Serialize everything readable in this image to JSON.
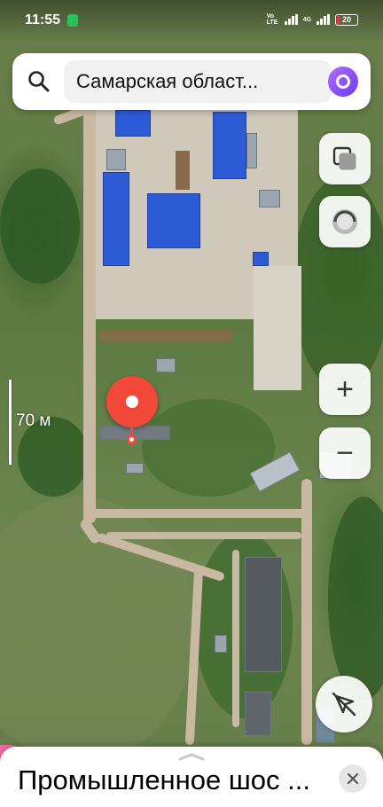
{
  "status_bar": {
    "time": "11:55",
    "volte_tag": "Vo LTE",
    "network_tag": "4G",
    "battery_level": "20",
    "battery_color": "#e23b3b"
  },
  "search": {
    "value": "Самарская област...",
    "icon": "search-icon",
    "assistant_icon": "alice-icon"
  },
  "controls": {
    "layers_icon": "layers-icon",
    "traffic_icon": "speedometer-icon",
    "zoom_in_label": "+",
    "zoom_out_label": "−",
    "location_icon": "location-arrow-off-icon"
  },
  "scale": {
    "label": "70 м"
  },
  "pin": {
    "color": "#f2483a"
  },
  "sheet": {
    "title": "Промышленное шос ...",
    "close_icon": "close-icon"
  }
}
